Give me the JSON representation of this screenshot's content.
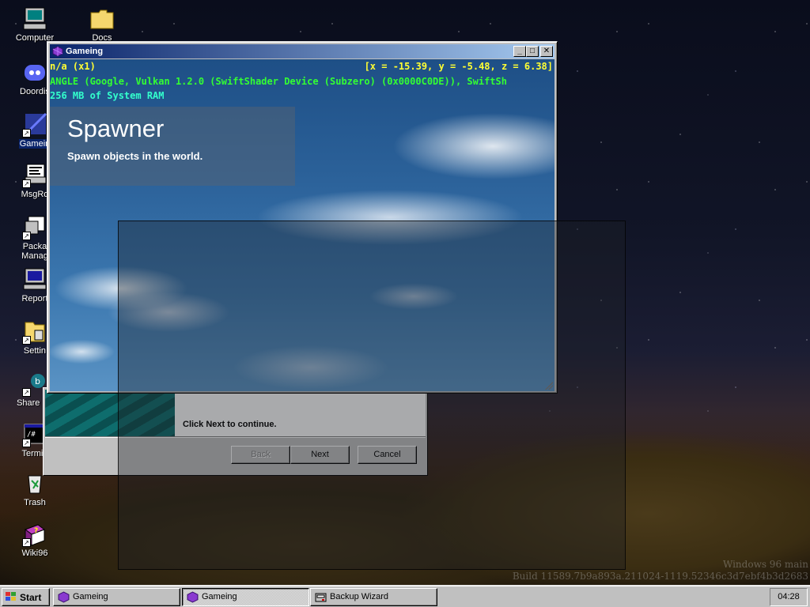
{
  "desktop": {
    "icons": [
      {
        "label": "Computer",
        "icon": "computer-icon"
      },
      {
        "label": "Docs",
        "icon": "folder-icon"
      },
      {
        "label": "Doordis",
        "icon": "discord-icon"
      },
      {
        "label": "Gamein",
        "icon": "game-shortcut-icon"
      },
      {
        "label": "MsgRo",
        "icon": "message-room-icon"
      },
      {
        "label": "Packa\nManag",
        "icon": "package-manager-icon"
      },
      {
        "label": "Report",
        "icon": "report-icon"
      },
      {
        "label": "Settin",
        "icon": "settings-icon"
      },
      {
        "label": "Share Be",
        "icon": "share-icon"
      },
      {
        "label": "Termin",
        "icon": "terminal-icon"
      },
      {
        "label": "Trash",
        "icon": "trash-icon"
      },
      {
        "label": "Wiki96",
        "icon": "wiki-book-icon"
      }
    ],
    "watermark_line1": "Windows 96 main",
    "watermark_line2": "Build 11589.7b9a893a.211024-1119.52346c3d7ebf4b3d2683"
  },
  "game_window": {
    "title": "Gameing",
    "controls": {
      "minimize": "_",
      "maximize": "□",
      "close": "✕"
    },
    "debug": {
      "fps": "n/a (x1)",
      "coords": "[x = -15.39, y = -5.48, z = 6.38]",
      "renderer": "ANGLE (Google, Vulkan 1.2.0 (SwiftShader Device (Subzero) (0x0000C0DE)), SwiftSh",
      "memory": "256 MB of System RAM"
    },
    "panel": {
      "title": "Spawner",
      "subtitle": "Spawn objects in the world."
    }
  },
  "wizard": {
    "message": "Click Next to continue.",
    "back_label": "Back",
    "next_label": "Next",
    "cancel_label": "Cancel"
  },
  "taskbar": {
    "start_label": "Start",
    "tasks": [
      {
        "label": "Gameing"
      },
      {
        "label": "Gameing"
      },
      {
        "label": "Backup Wizard"
      }
    ],
    "clock": "04:28"
  },
  "colors": {
    "debug_yellow": "#ffff33",
    "debug_green": "#33ff33",
    "debug_cyan": "#33ffcc",
    "title_active_start": "#0a246a",
    "title_active_end": "#a6caf0"
  }
}
